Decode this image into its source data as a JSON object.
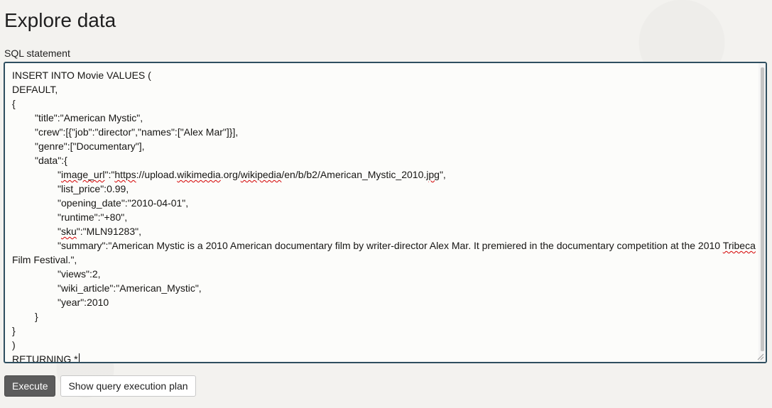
{
  "page": {
    "title": "Explore data"
  },
  "form": {
    "sql_label": "SQL statement",
    "sql_lines": [
      {
        "indent": 0,
        "text": "INSERT INTO Movie VALUES ("
      },
      {
        "indent": 0,
        "text": "DEFAULT,"
      },
      {
        "indent": 0,
        "text": "{"
      },
      {
        "indent": 1,
        "text": "\"title\":\"American Mystic\","
      },
      {
        "indent": 1,
        "text": "\"crew\":[{\"job\":\"director\",\"names\":[\"Alex Mar\"]}],"
      },
      {
        "indent": 1,
        "text": "\"genre\":[\"Documentary\"],"
      },
      {
        "indent": 1,
        "text": "\"data\":{"
      },
      {
        "indent": 2,
        "text": "\"image_url\":\"https://upload.wikimedia.org/wikipedia/en/b/b2/American_Mystic_2010.jpg\","
      },
      {
        "indent": 2,
        "text": "\"list_price\":0.99,"
      },
      {
        "indent": 2,
        "text": "\"opening_date\":\"2010-04-01\","
      },
      {
        "indent": 2,
        "text": "\"runtime\":\"+80\","
      },
      {
        "indent": 2,
        "text": "\"sku\":\"MLN91283\","
      },
      {
        "indent": 2,
        "text": "\"summary\":\"American Mystic is a 2010 American documentary film by writer-director Alex Mar. It premiered in the documentary competition at the 2010 Tribeca"
      },
      {
        "indent": 0,
        "text": "Film Festival.\","
      },
      {
        "indent": 2,
        "text": "\"views\":2,"
      },
      {
        "indent": 2,
        "text": "\"wiki_article\":\"American_Mystic\","
      },
      {
        "indent": 2,
        "text": "\"year\":2010"
      },
      {
        "indent": 1,
        "text": "}"
      },
      {
        "indent": 0,
        "text": "}"
      },
      {
        "indent": 0,
        "text": ")"
      },
      {
        "indent": 0,
        "text": "RETURNING *"
      }
    ]
  },
  "actions": {
    "execute_label": "Execute",
    "plan_label": "Show query execution plan"
  },
  "colors": {
    "editor_border": "#2f4f60",
    "execute_bg": "#5c5c5c",
    "spellcheck": "#d40000"
  }
}
